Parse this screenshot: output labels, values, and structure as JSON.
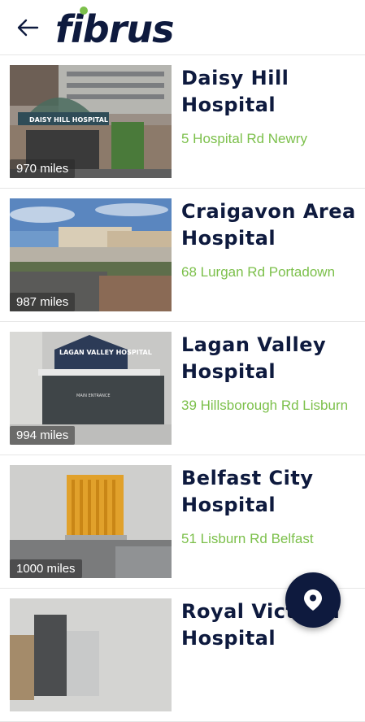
{
  "header": {
    "back_icon": "arrow-left-icon",
    "logo_text": "fibrus",
    "brand_colors": {
      "navy": "#0e1a3e",
      "green": "#7cc04b"
    }
  },
  "hospitals": [
    {
      "name": "Daisy Hill Hospital",
      "address": "5 Hospital Rd Newry",
      "distance": "970 miles",
      "sign_text": "DAISY HILL HOSPITAL"
    },
    {
      "name": "Craigavon Area Hospital",
      "address": "68 Lurgan Rd Portadown",
      "distance": "987 miles"
    },
    {
      "name": "Lagan Valley Hospital",
      "address": "39 Hillsborough Rd Lisburn",
      "distance": "994 miles",
      "sign_text": "LAGAN VALLEY HOSPITAL",
      "sign_text_2": "MAIN ENTRANCE"
    },
    {
      "name": "Belfast City Hospital",
      "address": "51 Lisburn Rd Belfast",
      "distance": "1000 miles"
    },
    {
      "name": "Royal Victoria Hospital",
      "address": "",
      "distance": ""
    }
  ],
  "fab": {
    "icon": "map-pin-icon"
  }
}
